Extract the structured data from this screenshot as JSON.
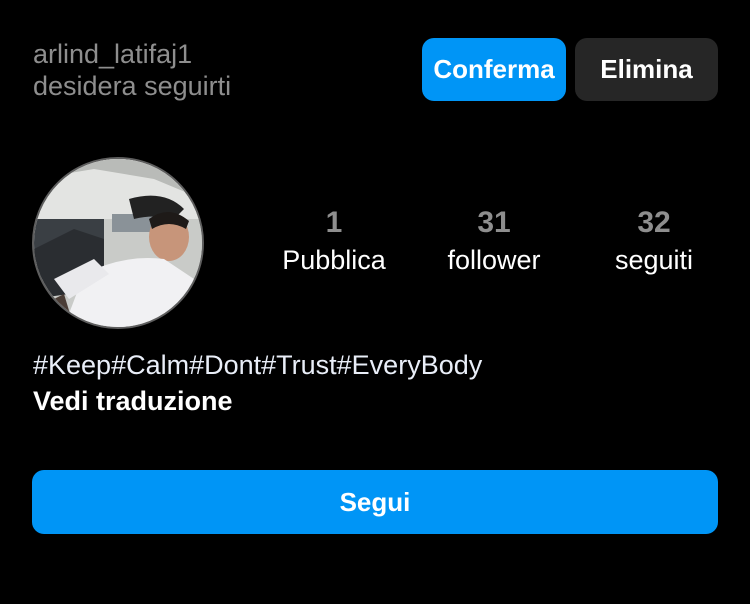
{
  "follow_request": {
    "username": "arlind_latifaj1",
    "message": "desidera seguirti",
    "confirm_label": "Conferma",
    "delete_label": "Elimina"
  },
  "profile": {
    "stats": [
      {
        "value": "1",
        "label": "Pubblica"
      },
      {
        "value": "31",
        "label": "follower"
      },
      {
        "value": "32",
        "label": "seguiti"
      }
    ],
    "bio": "#Keep#Calm#Dont#Trust#EveryBody",
    "translate_label": "Vedi traduzione",
    "follow_label": "Segui"
  },
  "colors": {
    "primary_button": "#0095f6",
    "secondary_button": "#262626",
    "muted_text": "#8e8e8e",
    "background": "#000000"
  }
}
